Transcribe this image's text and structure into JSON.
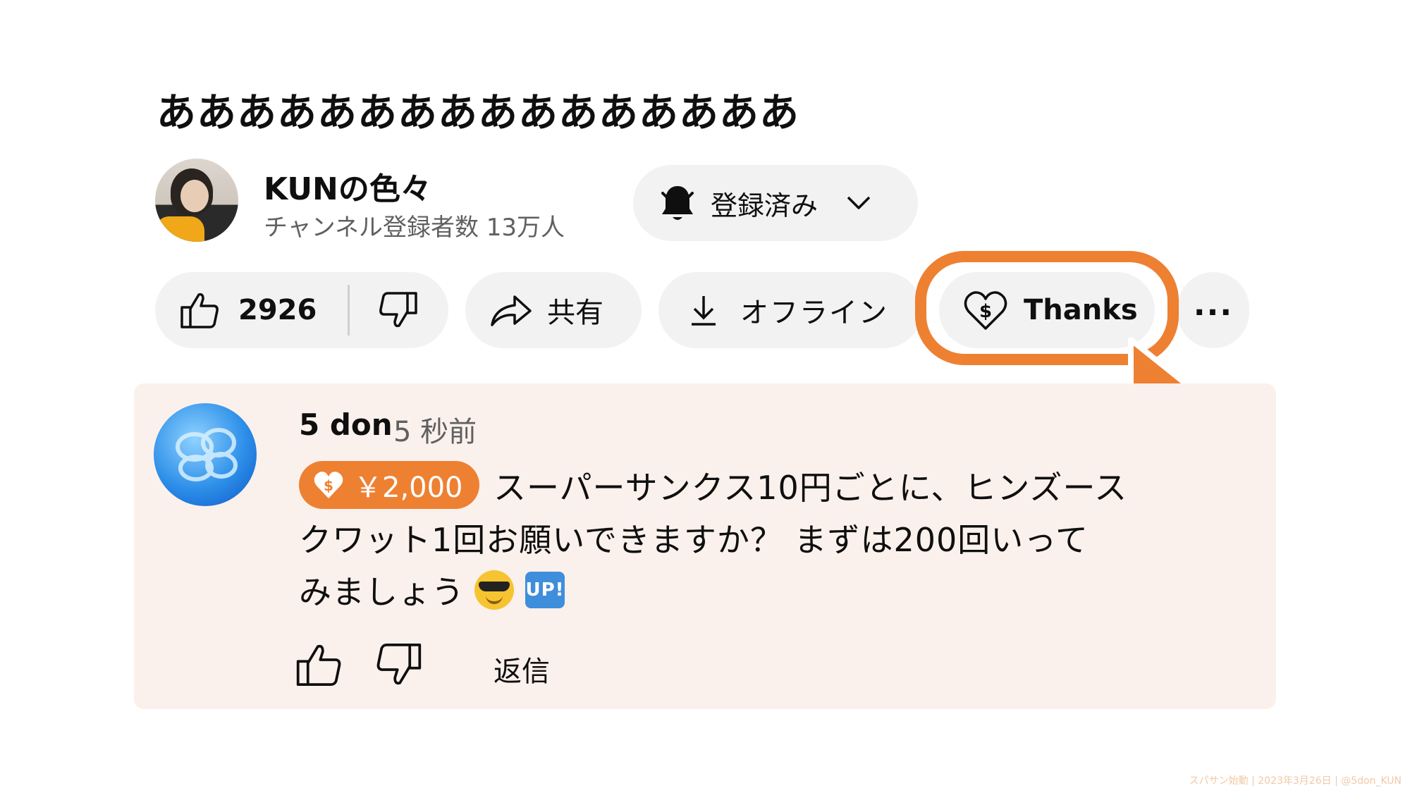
{
  "video": {
    "title": "ああああああああああああああああ"
  },
  "channel": {
    "name": "KUNの色々",
    "subscribers": "チャンネル登録者数 13万人",
    "avatar_icon": "channel-avatar-image"
  },
  "subscribe_button": {
    "label": "登録済み",
    "bell_icon": "bell-icon",
    "chevron_icon": "chevron-down-icon"
  },
  "actions": {
    "like_count": "2926",
    "share_label": "共有",
    "offline_label": "オフライン",
    "thanks_label": "Thanks",
    "more_label": "..."
  },
  "highlight": {
    "color": "#ee8032"
  },
  "comment": {
    "author": "5 don",
    "time": "5 秒前",
    "amount": "￥2,000",
    "text_line_1": "スーパーサンクス10円ごとに、ヒンズース",
    "text_line_2": "クワット1回お願いできますか？ まずは200回いって",
    "text_line_3": "みましょう",
    "emoji_1": "sunglasses-emoji",
    "emoji_2": "UP!",
    "reply_label": "返信",
    "background": "#fbf1ec"
  },
  "footer": {
    "credit": "スパサン始動 | 2023年3月26日 | @5don_KUN"
  }
}
